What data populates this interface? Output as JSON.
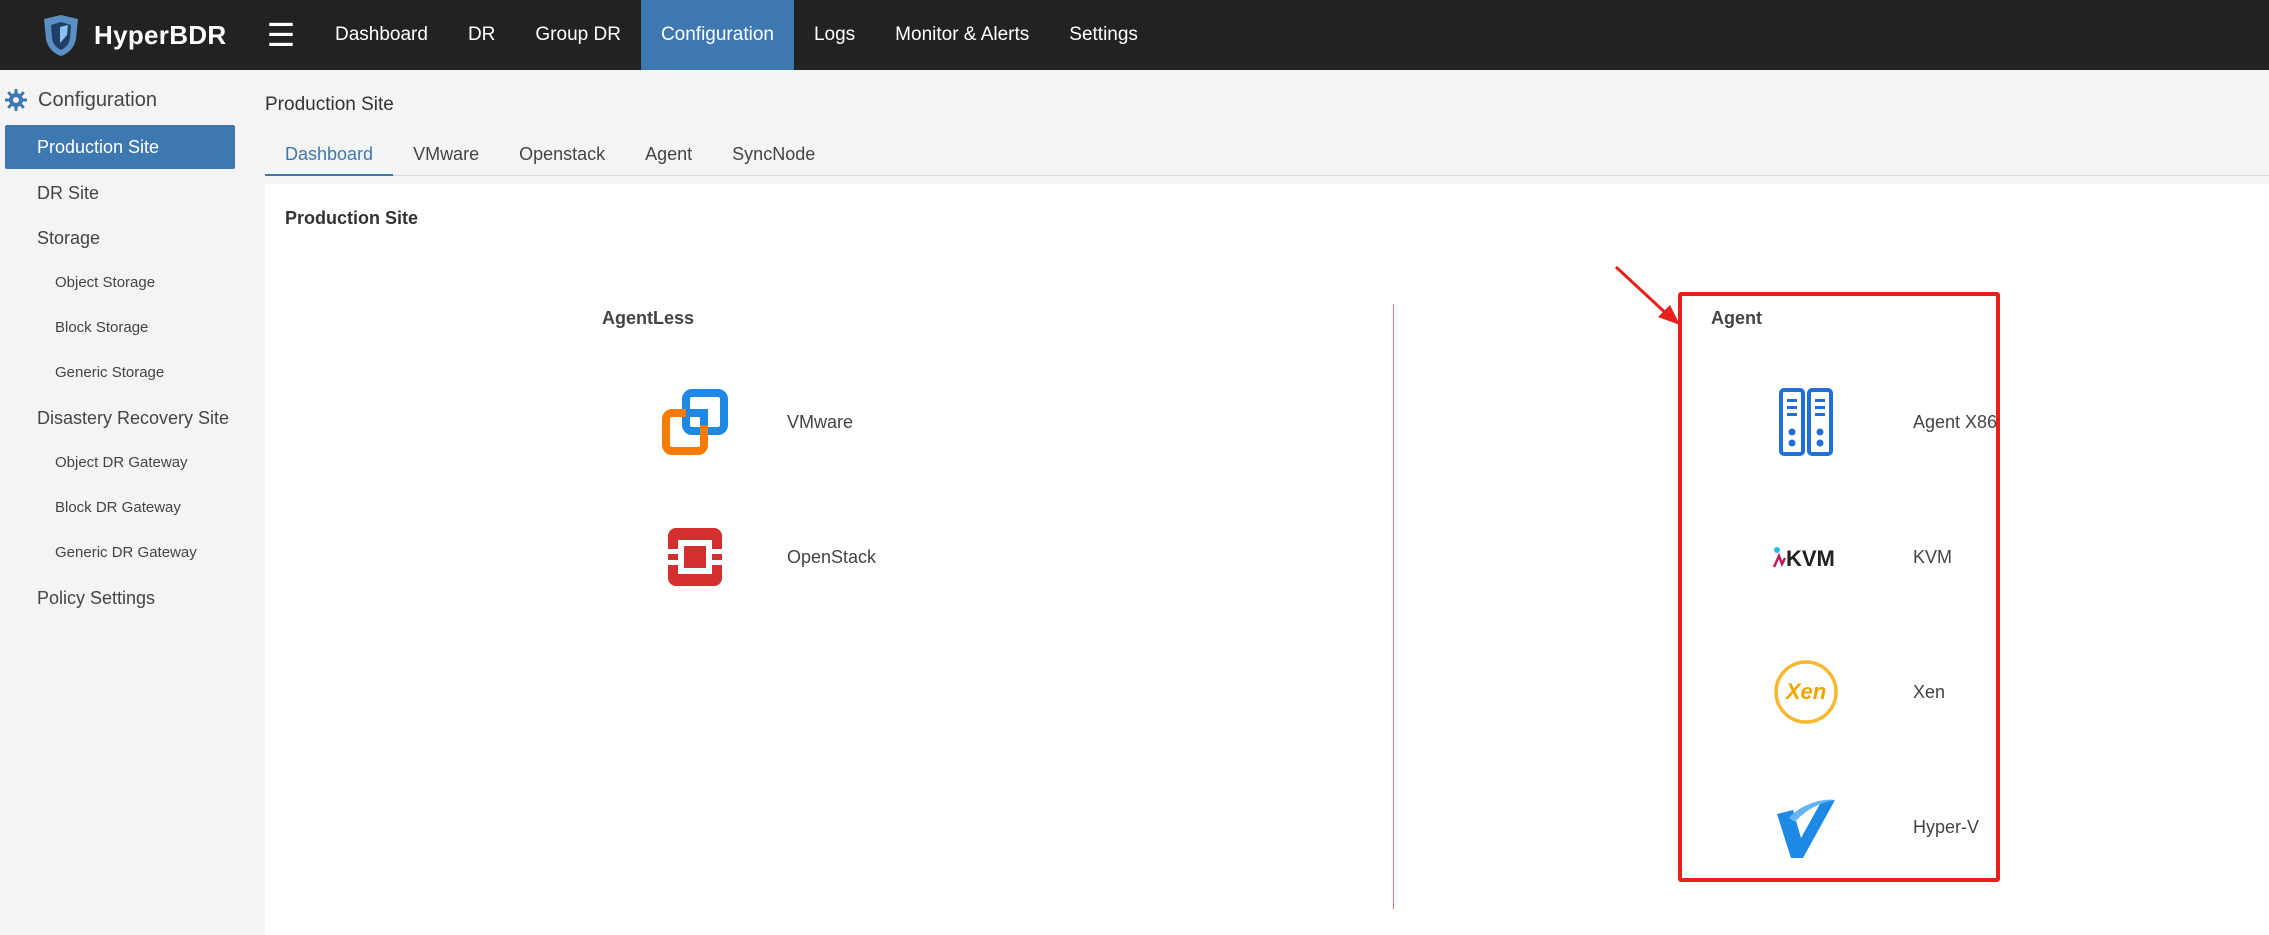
{
  "app": {
    "name": "HyperBDR"
  },
  "topnav": [
    {
      "label": "Dashboard"
    },
    {
      "label": "DR"
    },
    {
      "label": "Group DR"
    },
    {
      "label": "Configuration"
    },
    {
      "label": "Logs"
    },
    {
      "label": "Monitor & Alerts"
    },
    {
      "label": "Settings"
    }
  ],
  "topnav_active": "Configuration",
  "sidebar": {
    "heading": "Configuration",
    "items": [
      {
        "label": "Production Site"
      },
      {
        "label": "DR Site"
      },
      {
        "label": "Storage"
      },
      {
        "label": "Object Storage"
      },
      {
        "label": "Block Storage"
      },
      {
        "label": "Generic Storage"
      },
      {
        "label": "Disastery Recovery Site"
      },
      {
        "label": "Object DR Gateway"
      },
      {
        "label": "Block DR Gateway"
      },
      {
        "label": "Generic DR Gateway"
      },
      {
        "label": "Policy Settings"
      }
    ],
    "active": "Production Site"
  },
  "page": {
    "title": "Production Site",
    "tabs": [
      {
        "label": "Dashboard"
      },
      {
        "label": "VMware"
      },
      {
        "label": "Openstack"
      },
      {
        "label": "Agent"
      },
      {
        "label": "SyncNode"
      }
    ],
    "active_tab": "Dashboard",
    "panel_title": "Production Site",
    "agentless": {
      "title": "AgentLess",
      "items": [
        {
          "label": "VMware",
          "icon": "vmware-icon"
        },
        {
          "label": "OpenStack",
          "icon": "openstack-icon"
        }
      ]
    },
    "agent": {
      "title": "Agent",
      "items": [
        {
          "label": "Agent X86",
          "icon": "server-icon"
        },
        {
          "label": "KVM",
          "icon": "kvm-icon",
          "icon_text": "KVM"
        },
        {
          "label": "Xen",
          "icon": "xen-icon",
          "icon_text": "Xen"
        },
        {
          "label": "Hyper-V",
          "icon": "hyperv-icon"
        }
      ]
    }
  },
  "colors": {
    "topbar": "#222222",
    "accent": "#3d78b1",
    "highlight": "#e8201c",
    "divider": "#d9534f"
  }
}
